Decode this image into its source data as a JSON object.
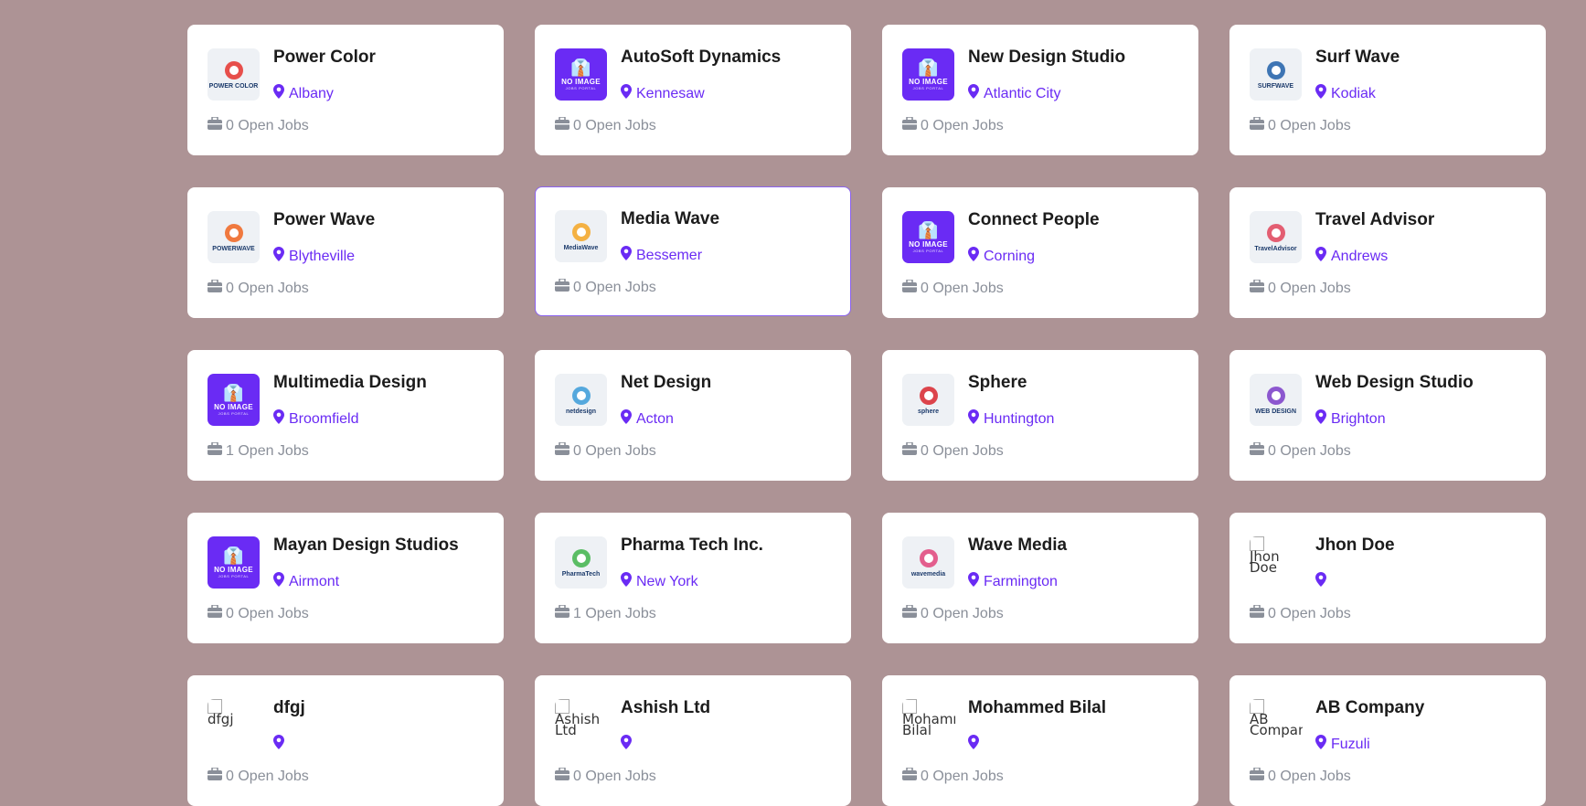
{
  "colors": {
    "background": "#ad9395",
    "accent": "#6a2bf4",
    "muted": "#8a8f99"
  },
  "companies": [
    {
      "name": "Power Color",
      "location": "Albany",
      "jobs": "0 Open Jobs",
      "logo": {
        "type": "brand",
        "text": "POWER COLOR",
        "color": "#e5322d"
      }
    },
    {
      "name": "AutoSoft Dynamics",
      "location": "Kennesaw",
      "jobs": "0 Open Jobs",
      "logo": {
        "type": "noimage",
        "line1": "NO IMAGE",
        "line2": "JOBS PORTAL"
      }
    },
    {
      "name": "New Design Studio",
      "location": "Atlantic City",
      "jobs": "0 Open Jobs",
      "logo": {
        "type": "noimage",
        "line1": "NO IMAGE",
        "line2": "JOBS PORTAL"
      }
    },
    {
      "name": "Surf Wave",
      "location": "Kodiak",
      "jobs": "0 Open Jobs",
      "logo": {
        "type": "brand",
        "text": "SURFWAVE",
        "color": "#1e5fa8"
      }
    },
    {
      "name": "Power Wave",
      "location": "Blytheville",
      "jobs": "0 Open Jobs",
      "logo": {
        "type": "brand",
        "text": "POWERWAVE",
        "color": "#f0641e"
      }
    },
    {
      "name": "Media Wave",
      "location": "Bessemer",
      "jobs": "0 Open Jobs",
      "logo": {
        "type": "brand",
        "text": "MediaWave",
        "color": "#f5a623"
      },
      "highlight": true
    },
    {
      "name": "Connect People",
      "location": "Corning",
      "jobs": "0 Open Jobs",
      "logo": {
        "type": "noimage",
        "line1": "NO IMAGE",
        "line2": "JOBS PORTAL"
      }
    },
    {
      "name": "Travel Advisor",
      "location": "Andrews",
      "jobs": "0 Open Jobs",
      "logo": {
        "type": "brand",
        "text": "TravelAdvisor",
        "color": "#e0445a"
      }
    },
    {
      "name": "Multimedia Design",
      "location": "Broomfield",
      "jobs": "1 Open Jobs",
      "logo": {
        "type": "noimage",
        "line1": "NO IMAGE",
        "line2": "JOBS PORTAL"
      }
    },
    {
      "name": "Net Design",
      "location": "Acton",
      "jobs": "0 Open Jobs",
      "logo": {
        "type": "brand",
        "text": "netdesign",
        "color": "#3a9bd8"
      }
    },
    {
      "name": "Sphere",
      "location": "Huntington",
      "jobs": "0 Open Jobs",
      "logo": {
        "type": "brand",
        "text": "sphere",
        "color": "#d8262d"
      }
    },
    {
      "name": "Web Design Studio",
      "location": "Brighton",
      "jobs": "0 Open Jobs",
      "logo": {
        "type": "brand",
        "text": "WEB DESIGN",
        "color": "#7a3cc8"
      }
    },
    {
      "name": "Mayan Design Studios",
      "location": "Airmont",
      "jobs": "0 Open Jobs",
      "logo": {
        "type": "noimage",
        "line1": "NO IMAGE",
        "line2": "JOBS PORTAL"
      }
    },
    {
      "name": "Pharma Tech Inc.",
      "location": "New York",
      "jobs": "1 Open Jobs",
      "logo": {
        "type": "brand",
        "text": "PharmaTech",
        "color": "#3fb44a"
      }
    },
    {
      "name": "Wave Media",
      "location": "Farmington",
      "jobs": "0 Open Jobs",
      "logo": {
        "type": "brand",
        "text": "wavemedia",
        "color": "#e0447a"
      }
    },
    {
      "name": "Jhon Doe",
      "location": "",
      "jobs": "0 Open Jobs",
      "logo": {
        "type": "broken",
        "alt": "Jhon Doe"
      }
    },
    {
      "name": "dfgj",
      "location": "",
      "jobs": "0 Open Jobs",
      "logo": {
        "type": "broken",
        "alt": "dfgj"
      }
    },
    {
      "name": "Ashish Ltd",
      "location": "",
      "jobs": "0 Open Jobs",
      "logo": {
        "type": "broken",
        "alt": "Ashish Ltd"
      }
    },
    {
      "name": "Mohammed Bilal",
      "location": "",
      "jobs": "0 Open Jobs",
      "logo": {
        "type": "broken",
        "alt": "Mohammed Bilal"
      }
    },
    {
      "name": "AB Company",
      "location": "Fuzuli",
      "jobs": "0 Open Jobs",
      "logo": {
        "type": "broken",
        "alt": "AB Company"
      }
    }
  ]
}
